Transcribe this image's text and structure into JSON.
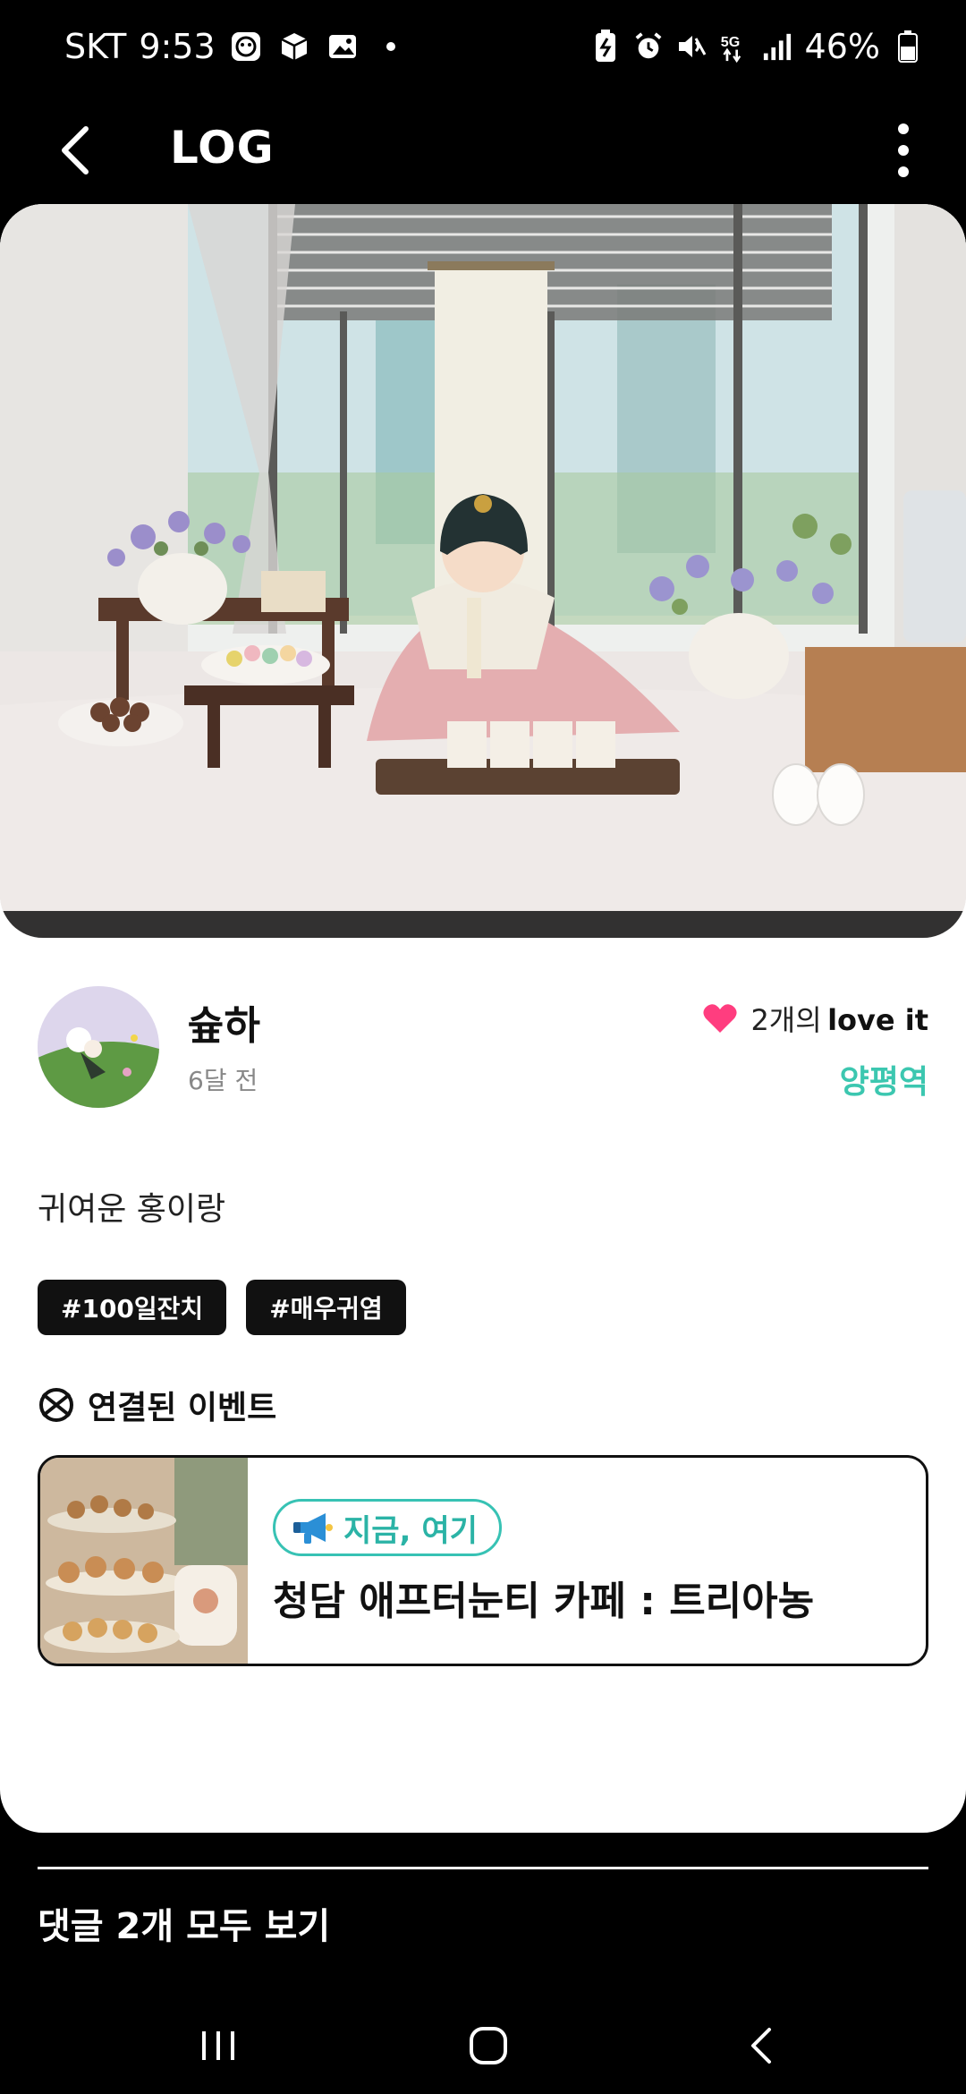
{
  "status_bar": {
    "carrier": "SKT",
    "time": "9:53",
    "battery": "46%",
    "left_icons": [
      "sticker-icon",
      "box-icon",
      "gallery-icon",
      "dot-icon"
    ],
    "right_icons": [
      "battery-saver-icon",
      "alarm-icon",
      "mute-icon",
      "5g-icon",
      "signal-icon",
      "battery-icon"
    ]
  },
  "app_bar": {
    "title": "LOG"
  },
  "post": {
    "author": "슢하",
    "time_ago": "6달 전",
    "love_count": "2개의",
    "love_label": "love it",
    "location": "양평역",
    "caption": "귀여운 홍이랑",
    "tags": [
      "#100일잔치",
      "#매우귀염"
    ]
  },
  "linked": {
    "heading": "연결된 이벤트",
    "event": {
      "badge": "지금, 여기",
      "title": "청담 애프터눈티 카페 : 트리아농"
    }
  },
  "comments": {
    "link": "댓글 2개 모두 보기"
  },
  "colors": {
    "accent": "#3cc7b0",
    "heart": "#ff3d7f",
    "background": "#000000",
    "card": "#ffffff"
  }
}
